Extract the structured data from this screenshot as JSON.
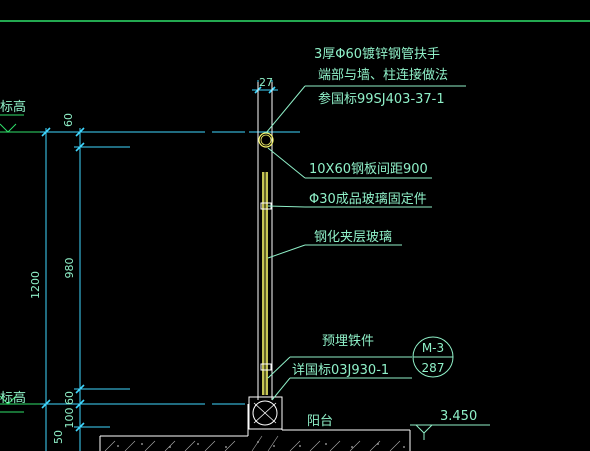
{
  "colors": {
    "background": "#000000",
    "annotation": "#8ff0c8",
    "dimension": "#3fd7ff",
    "railing": "#f5f56a",
    "structure": "#ffffff",
    "hatch": "#b0b0b0",
    "top_line": "#2fe06a"
  },
  "annotations": {
    "line1": "3厚Φ60镀锌钢管扶手",
    "line2": "端部与墙、柱连接做法",
    "line3": "参国标99SJ403-37-1",
    "plate": "10X60钢板间距900",
    "fixing": "Φ30成品玻璃固定件",
    "glass": "钢化夹层玻璃",
    "embed": "预埋铁件",
    "detail_ref": "详国标03J930-1",
    "bubble_top": "M-3",
    "bubble_bottom": "287",
    "balcony": "阳台",
    "elevation_value": "3.450",
    "biaogao_top": "标高",
    "biaogao_bottom": "标高"
  },
  "dimensions": {
    "d27": "27",
    "d60_top": "60",
    "d980": "980",
    "d1200": "1200",
    "d60_bottom": "60",
    "d100": "100",
    "d50": "50"
  }
}
